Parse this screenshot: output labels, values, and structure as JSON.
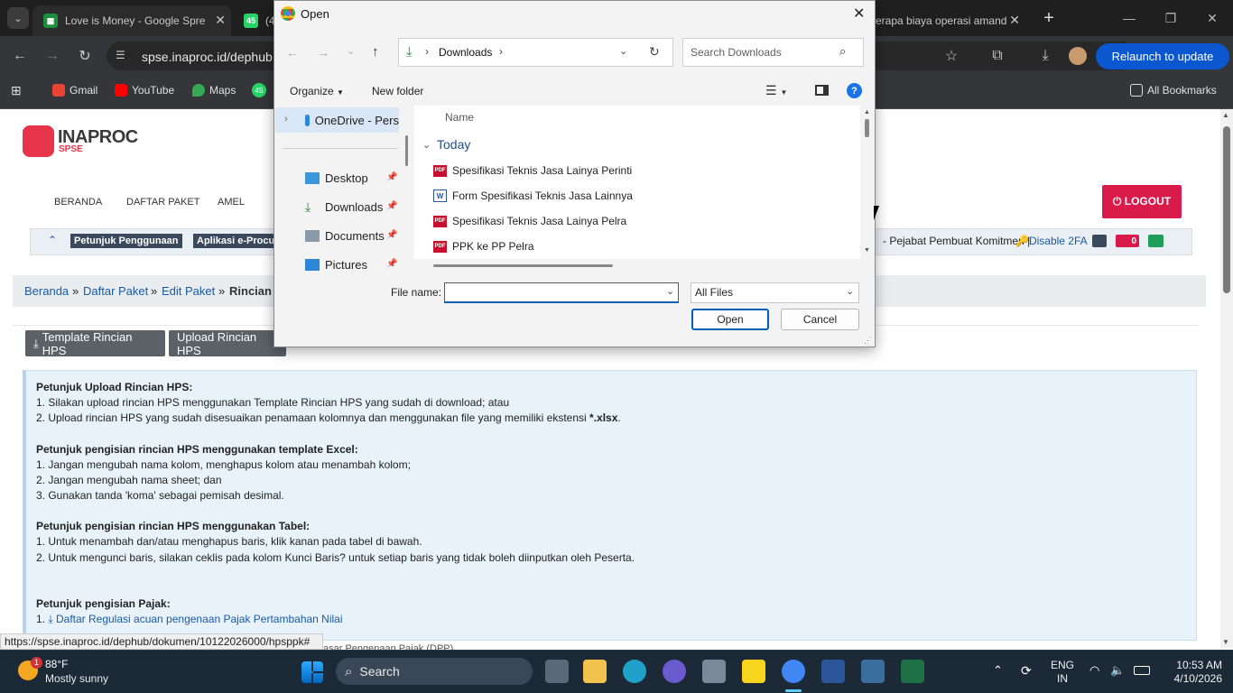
{
  "browser": {
    "tabs": [
      {
        "label": "Love is Money - Google Spre",
        "favicon": "sheets-icon",
        "color": "#1e8e3e"
      },
      {
        "label": "(4",
        "favicon": "whatsapp-icon",
        "color": "#25d366"
      },
      {
        "label": "erapa biaya operasi amand",
        "favicon": "",
        "color": ""
      }
    ],
    "url": "spse.inaproc.id/dephub",
    "relaunch_label": "Relaunch to update",
    "bookmarks": [
      {
        "label": "Gmail",
        "color": "#ea4335"
      },
      {
        "label": "YouTube",
        "color": "#ff0000"
      },
      {
        "label": "Maps",
        "color": "#34a853"
      },
      {
        "label": "45",
        "color": "#25d366"
      }
    ],
    "all_bookmarks_label": "All Bookmarks"
  },
  "page": {
    "logo_name": "INAPROC",
    "logo_sub": "SPSE",
    "nav": [
      "BERANDA",
      "DAFTAR PAKET",
      "AMEL"
    ],
    "logout_label": "⏻ LOGOUT",
    "chips": [
      "Petunjuk Penggunaan",
      "Aplikasi e-Procure"
    ],
    "user_info": "- Pejabat Pembuat Komitmen |",
    "disable_2fa": "Disable 2FA",
    "mail_count": "0",
    "breadcrumb": [
      "Beranda",
      "Daftar Paket",
      "Edit Paket",
      "Rincian I"
    ],
    "template_button": "Template Rincian HPS",
    "upload_button": "Upload Rincian HPS",
    "info": {
      "h1": "Petunjuk Upload Rincian HPS:",
      "l1": "1. Silakan upload rincian HPS menggunakan Template Rincian HPS yang sudah di download; atau",
      "l2a": "2. Upload rincian HPS yang sudah disesuaikan penamaan kolomnya dan menggunakan file yang memiliki ekstensi ",
      "l2b": "*.xlsx",
      "l2c": ".",
      "h2": "Petunjuk pengisian rincian HPS menggunakan template Excel:",
      "l3": "1. Jangan mengubah nama kolom, menghapus kolom atau menambah kolom;",
      "l4": "2. Jangan mengubah nama sheet; dan",
      "l5": "3. Gunakan tanda 'koma' sebagai pemisah desimal.",
      "h3": "Petunjuk pengisian rincian HPS menggunakan Tabel:",
      "l6": "1. Untuk menambah dan/atau menghapus baris, klik kanan pada tabel di bawah.",
      "l7": "2. Untuk mengunci baris, silakan ceklis pada kolom Kunci Baris? untuk setiap baris yang tidak boleh diinputkan oleh Peserta.",
      "h4": "Petunjuk pengisian Pajak:",
      "l8a": "1. ",
      "l8b": "Daftar Regulasi acuan pengenaan Pajak Pertambahan Nilai",
      "l9": "asar Pengenaan Pajak (DPP)"
    },
    "status_url": "https://spse.inaproc.id/dephub/dokumen/10122026000/hpsppk#"
  },
  "dialog": {
    "title": "Open",
    "path": "Downloads",
    "search_placeholder": "Search Downloads",
    "organize_label": "Organize",
    "new_folder_label": "New folder",
    "nav_items": [
      {
        "label": "OneDrive - Pers",
        "icon": "onedrive-icon"
      },
      {
        "label": "Desktop",
        "icon": "desktop-icon"
      },
      {
        "label": "Downloads",
        "icon": "download-icon"
      },
      {
        "label": "Documents",
        "icon": "documents-icon"
      },
      {
        "label": "Pictures",
        "icon": "pictures-icon"
      }
    ],
    "column_name": "Name",
    "group_label": "Today",
    "files": [
      {
        "name": "Spesifikasi Teknis Jasa Lainya Perinti",
        "type": "pdf"
      },
      {
        "name": "Form Spesifikasi Teknis Jasa Lainnya",
        "type": "doc"
      },
      {
        "name": "Spesifikasi Teknis Jasa Lainya Pelra",
        "type": "pdf"
      },
      {
        "name": "PPK ke PP Pelra",
        "type": "pdf"
      }
    ],
    "file_name_label": "File name:",
    "file_name_value": "",
    "file_type": "All Files",
    "open_label": "Open",
    "cancel_label": "Cancel"
  },
  "taskbar": {
    "weather_temp": "88°F",
    "weather_desc": "Mostly sunny",
    "weather_badge": "1",
    "search_label": "Search",
    "lang": "ENG",
    "region": "IN",
    "time": "10:53 AM",
    "date": "4/10/2026"
  }
}
